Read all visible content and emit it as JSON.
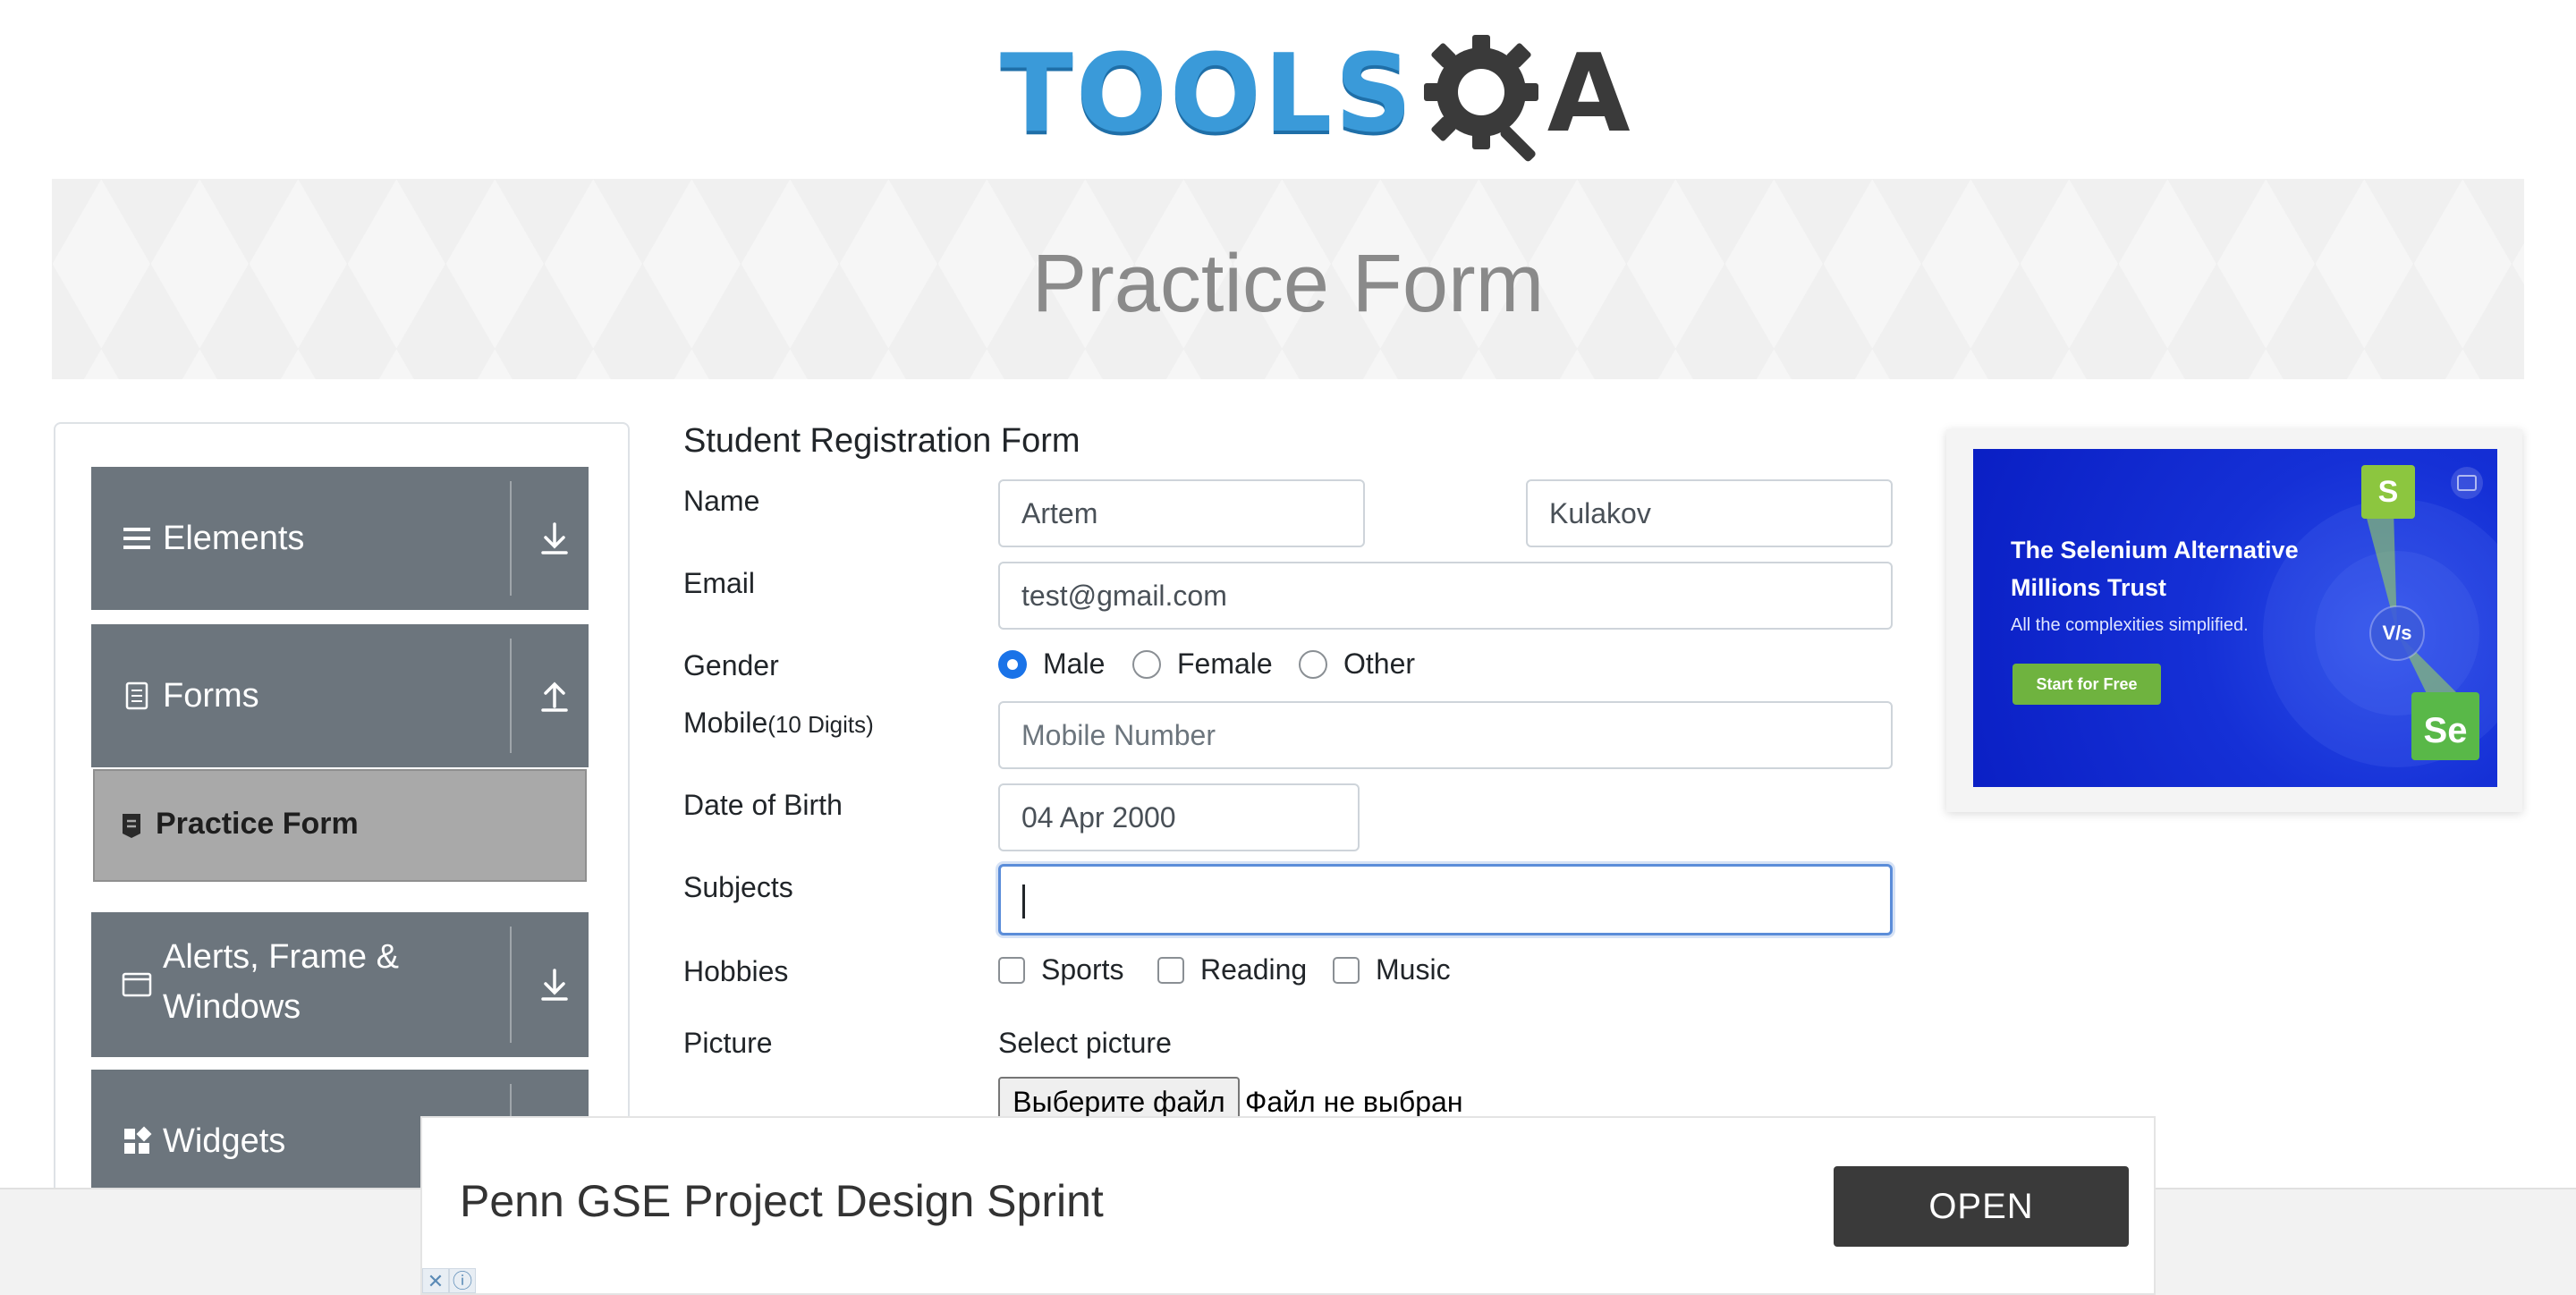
{
  "header": {
    "logo_tools": "TOOLS",
    "logo_a": "A",
    "banner_title": "Practice Form"
  },
  "sidebar": {
    "groups": [
      {
        "label": "Elements",
        "icon": "hamburger-icon",
        "arrow": "download-arrow-icon"
      },
      {
        "label": "Forms",
        "icon": "document-icon",
        "arrow": "upload-arrow-icon"
      },
      {
        "label": "Alerts, Frame & Windows",
        "label_line1": "Alerts, Frame &",
        "label_line2": "Windows",
        "icon": "window-icon",
        "arrow": "download-arrow-icon"
      },
      {
        "label": "Widgets",
        "icon": "widgets-icon"
      }
    ],
    "active_item": {
      "label": "Practice Form",
      "icon": "form-doc-icon"
    }
  },
  "form": {
    "title": "Student Registration Form",
    "name_label": "Name",
    "first_name": "Artem",
    "last_name": "Kulakov",
    "email_label": "Email",
    "email": "test@gmail.com",
    "gender_label": "Gender",
    "gender_options": [
      "Male",
      "Female",
      "Other"
    ],
    "gender_selected": "Male",
    "mobile_label": "Mobile",
    "mobile_hint": "(10 Digits)",
    "mobile_placeholder": "Mobile Number",
    "dob_label": "Date of Birth",
    "dob": "04 Apr 2000",
    "subjects_label": "Subjects",
    "subjects_value": "",
    "hobbies_label": "Hobbies",
    "hobbies": [
      "Sports",
      "Reading",
      "Music"
    ],
    "picture_label": "Picture",
    "select_picture": "Select picture",
    "file_button": "Выберите файл",
    "file_status": "Файл не выбран"
  },
  "right_ad": {
    "headline": "The Selenium Alternative Millions Trust",
    "sub": "All the complexities simplified.",
    "button": "Start for Free",
    "badge_s": "S",
    "badge_vs": "V/s",
    "badge_se": "Se"
  },
  "bottom_ad": {
    "text": "Penn GSE Project Design Sprint",
    "button": "OPEN",
    "close_glyph": "✕",
    "info_glyph": "ⓘ"
  },
  "colors": {
    "sidebar_group": "#6c757d",
    "active_item": "#a9a9a9",
    "radio_selected": "#1a73e8",
    "focus_border": "#5b8dd9",
    "logo_blue": "#3a9ad9",
    "ad_green": "#6fb33f"
  }
}
